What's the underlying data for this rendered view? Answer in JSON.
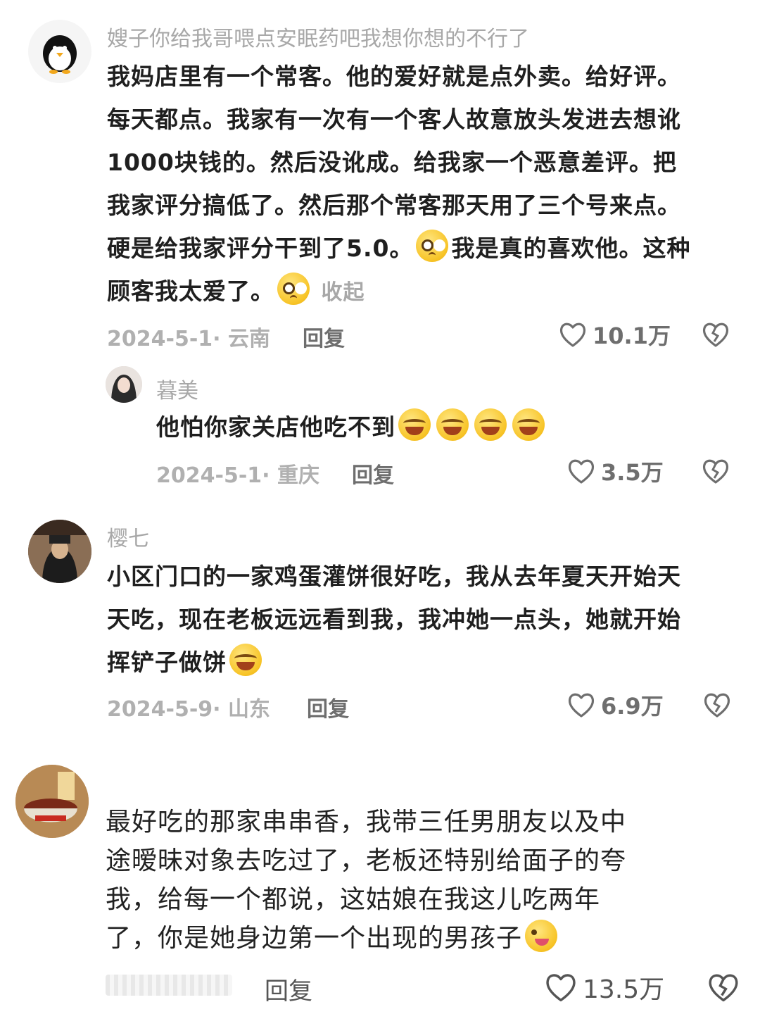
{
  "comments": [
    {
      "username": "嫂子你给我哥喂点安眠药吧我想你想的不行了",
      "lines": [
        "我妈店里有一个常客。他的爱好就是点外卖。给好评。",
        "每天都点。我家有一次有一个客人故意放头发进去想讹",
        "1000块钱的。然后没讹成。给我家一个恶意差评。把",
        "我家评分搞低了。然后那个常客那天用了三个号来点。",
        "硬是给我家评分干到了5.0。",
        "我是真的喜欢他。这种",
        "顾客我太爱了。"
      ],
      "collapse_label": "收起",
      "date_location": "2024-5-1· 云南",
      "reply_label": "回复",
      "likes": "10.1万"
    },
    {
      "username": "暮美",
      "text": "他怕你家关店他吃不到",
      "date_location": "2024-5-1· 重庆",
      "reply_label": "回复",
      "likes": "3.5万"
    },
    {
      "username": "樱七",
      "lines": [
        "小区门口的一家鸡蛋灌饼很好吃，我从去年夏天开始天",
        "天吃，现在老板远远看到我，我冲她一点头，她就开始",
        "挥铲子做饼"
      ],
      "date_location": "2024-5-9· 山东",
      "reply_label": "回复",
      "likes": "6.9万"
    },
    {
      "lines": [
        "最好吃的那家串串香，我带三任男朋友以及中",
        "途暧昧对象去吃过了，老板还特别给面子的夸",
        "我，给每一个都说，这姑娘在我这儿吃两年",
        "了，你是她身边第一个出现的男孩子"
      ],
      "reply_label": "回复",
      "likes": "13.5万"
    }
  ],
  "icons": {
    "like": "heart-outline-icon",
    "dislike": "broken-heart-icon"
  }
}
